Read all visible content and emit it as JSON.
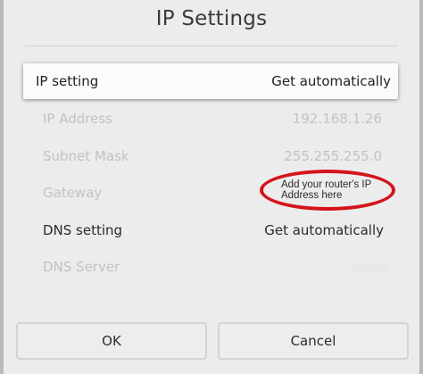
{
  "dialog": {
    "title": "IP Settings"
  },
  "rows": [
    {
      "label": "IP setting",
      "value": "Get automatically"
    },
    {
      "label": "IP Address",
      "value": "192.168.1.26"
    },
    {
      "label": "Subnet Mask",
      "value": "255.255.255.0"
    },
    {
      "label": "Gateway",
      "value": ""
    },
    {
      "label": "DNS setting",
      "value": "Get automatically"
    },
    {
      "label": "DNS Server",
      "value": ""
    }
  ],
  "annotation": {
    "text": "Add your router's IP Address here",
    "color": "#d3141a"
  },
  "buttons": {
    "ok": "OK",
    "cancel": "Cancel"
  }
}
